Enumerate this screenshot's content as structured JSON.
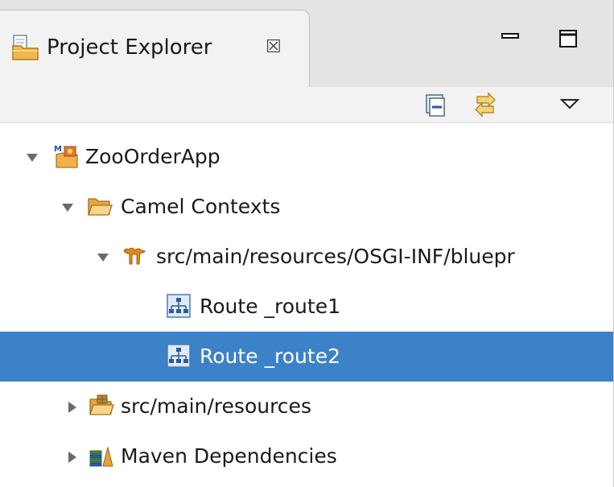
{
  "view": {
    "title": "Project Explorer",
    "close_glyph": "☒"
  },
  "icons": {
    "tab": "project-explorer-folder-icon",
    "minimize": "minimize-icon",
    "maximize": "maximize-icon",
    "collapse_all": "collapse-all-icon",
    "link_with_editor": "link-with-editor-icon",
    "view_menu": "view-menu-chevron-icon"
  },
  "colors": {
    "selection": "#3c82c8",
    "tab_bg": "#f2f2f2",
    "header_bg": "#e4e4e4"
  },
  "tree": {
    "items": [
      {
        "label": "ZooOrderApp",
        "icon": "maven-project-icon",
        "state": "expanded"
      },
      {
        "label": "Camel Contexts",
        "icon": "open-folder-icon",
        "state": "expanded"
      },
      {
        "label": "src/main/resources/OSGI-INF/bluepr",
        "icon": "camel-icon",
        "state": "expanded"
      },
      {
        "label": "Route _route1",
        "icon": "route-icon",
        "state": "leaf"
      },
      {
        "label": "Route _route2",
        "icon": "route-icon",
        "state": "leaf",
        "selected": true
      },
      {
        "label": "src/main/resources",
        "icon": "source-folder-icon",
        "state": "collapsed"
      },
      {
        "label": "Maven Dependencies",
        "icon": "library-icon",
        "state": "collapsed"
      }
    ]
  }
}
